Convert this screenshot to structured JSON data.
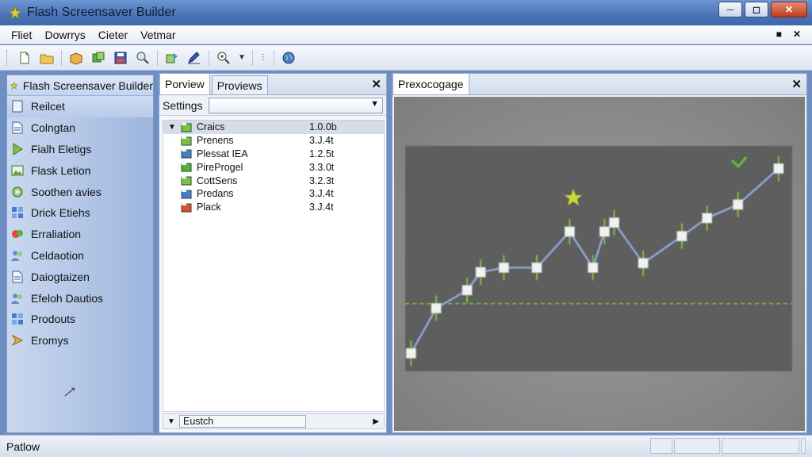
{
  "window": {
    "title": "Flash Screensaver Builder"
  },
  "menu": {
    "items": [
      "Fliet",
      "Dowrrys",
      "Cieter",
      "Vetmar"
    ]
  },
  "sidebar": {
    "header": "Flash Screensaver Builder",
    "items": [
      {
        "label": "Reilcet",
        "icon": "page-icon"
      },
      {
        "label": "Colngtan",
        "icon": "document-icon"
      },
      {
        "label": "Fialh Eletigs",
        "icon": "play-icon"
      },
      {
        "label": "Flask Letion",
        "icon": "image-icon"
      },
      {
        "label": "Soothen avies",
        "icon": "gear-icon"
      },
      {
        "label": "Drick Etiehs",
        "icon": "grid-icon"
      },
      {
        "label": "Erraliation",
        "icon": "paint-icon"
      },
      {
        "label": "Celdaotion",
        "icon": "people-icon"
      },
      {
        "label": "Daiogtaizen",
        "icon": "document-icon"
      },
      {
        "label": "Efeloh Dautios",
        "icon": "people-icon"
      },
      {
        "label": "Prodouts",
        "icon": "grid-icon"
      },
      {
        "label": "Eromys",
        "icon": "arrow-icon"
      }
    ]
  },
  "middle": {
    "tabs": [
      "Porview",
      "Proviews"
    ],
    "settings_label": "Settings",
    "settings_value": "",
    "tree": [
      {
        "name": "Craics",
        "value": "1.0.0b"
      },
      {
        "name": "Prenens",
        "value": "3.J.4t"
      },
      {
        "name": "Plessat IEA",
        "value": "1.2.5t"
      },
      {
        "name": "PireProgel",
        "value": "3.3.0t"
      },
      {
        "name": "CottSens",
        "value": "3.2.3t"
      },
      {
        "name": "Predans",
        "value": "3.J.4t"
      },
      {
        "name": "Plack",
        "value": "3.J.4t"
      }
    ],
    "footer_value": "Eustch"
  },
  "preview": {
    "tab": "Prexocogage",
    "line_color": "#8fa6d8",
    "threshold_color": "#7fbf3a",
    "points": [
      [
        0.015,
        0.92
      ],
      [
        0.08,
        0.72
      ],
      [
        0.16,
        0.64
      ],
      [
        0.195,
        0.56
      ],
      [
        0.255,
        0.54
      ],
      [
        0.34,
        0.54
      ],
      [
        0.425,
        0.38
      ],
      [
        0.485,
        0.54
      ],
      [
        0.515,
        0.38
      ],
      [
        0.54,
        0.34
      ],
      [
        0.615,
        0.52
      ],
      [
        0.715,
        0.4
      ],
      [
        0.78,
        0.32
      ],
      [
        0.86,
        0.26
      ],
      [
        0.965,
        0.1
      ]
    ],
    "threshold_y": 0.7
  },
  "status": {
    "text": "Patlow"
  }
}
